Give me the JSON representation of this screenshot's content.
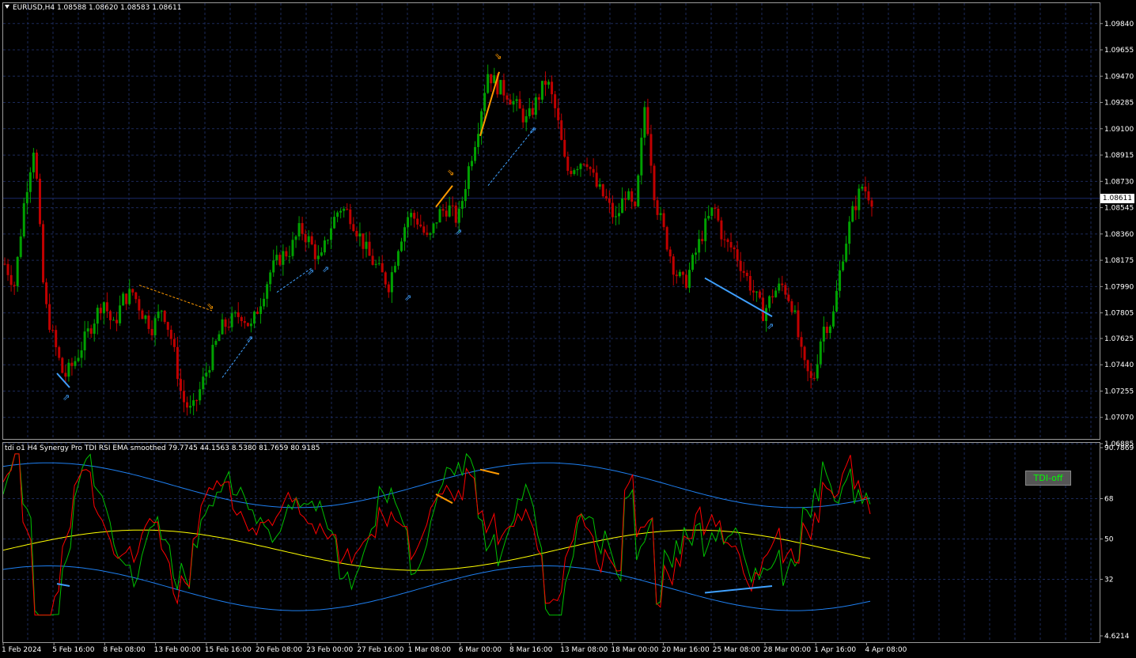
{
  "header": {
    "symbol_title": "EURUSD,H4  1.08588 1.08620 1.08583 1.08611",
    "indicator_title": "tdi o1 H4 Synergy Pro TDI RSI EMA smoothed  79.7745 44.1563 8.5380 81.7659 80.9185"
  },
  "buttons": {
    "tdi_off": "TDI-off"
  },
  "colors": {
    "background": "#000000",
    "grid": "#1c2a5a",
    "bull_candle": "#00a000",
    "bear_candle": "#c00000",
    "price_line": "#1c2a6a",
    "rsi_price": "#00c000",
    "signal_line": "#ff0000",
    "market_base": "#ffff00",
    "volatility_band": "#1e7ff0",
    "arrow_up": "#3fa0ff",
    "arrow_down": "#ff9a00",
    "divergence_bull": "#3fa0ff",
    "divergence_bear": "#ff9a00"
  },
  "chart_data": [
    {
      "type": "candlestick",
      "symbol": "EURUSD",
      "timeframe": "H4",
      "ylim": [
        1.06885,
        1.0995
      ],
      "price_ticks": [
        "1.09840",
        "1.09655",
        "1.09470",
        "1.09285",
        "1.09100",
        "1.08915",
        "1.08730",
        "1.08545",
        "1.08360",
        "1.08175",
        "1.07990",
        "1.07805",
        "1.07625",
        "1.07440",
        "1.07255",
        "1.07070",
        "1.06885"
      ],
      "current_price": "1.08611",
      "time_labels": [
        "1 Feb 2024",
        "5 Feb 16:00",
        "8 Feb 08:00",
        "13 Feb 00:00",
        "15 Feb 16:00",
        "20 Feb 08:00",
        "23 Feb 00:00",
        "27 Feb 16:00",
        "1 Mar 08:00",
        "6 Mar 00:00",
        "8 Mar 16:00",
        "13 Mar 08:00",
        "18 Mar 00:00",
        "20 Mar 16:00",
        "25 Mar 08:00",
        "28 Mar 00:00",
        "1 Apr 16:00",
        "4 Apr 08:00"
      ],
      "close_path": [
        1.0815,
        1.08,
        1.086,
        1.09,
        1.079,
        1.076,
        1.0735,
        1.0745,
        1.076,
        1.0775,
        1.079,
        1.077,
        1.079,
        1.0795,
        1.078,
        1.077,
        1.0785,
        1.076,
        1.072,
        1.071,
        1.073,
        1.075,
        1.077,
        1.0775,
        1.078,
        1.077,
        1.079,
        1.081,
        1.082,
        1.0825,
        1.084,
        1.083,
        1.0815,
        1.084,
        1.0855,
        1.085,
        1.0835,
        1.082,
        1.081,
        1.08,
        1.083,
        1.085,
        1.0845,
        1.083,
        1.085,
        1.0855,
        1.0845,
        1.088,
        1.091,
        1.095,
        1.094,
        1.0935,
        1.0925,
        1.0915,
        1.093,
        1.0945,
        1.092,
        1.088,
        1.0885,
        1.089,
        1.087,
        1.086,
        1.0845,
        1.0865,
        1.085,
        1.093,
        1.086,
        1.0835,
        1.081,
        1.08,
        1.082,
        1.084,
        1.0855,
        1.083,
        1.0825,
        1.081,
        1.0795,
        1.078,
        1.0795,
        1.08,
        1.0785,
        1.0745,
        1.073,
        1.077,
        1.0775,
        1.082,
        1.085,
        1.087,
        1.0861
      ],
      "signals": [
        {
          "kind": "buy",
          "price": 1.0722
        },
        {
          "kind": "sell",
          "price": 1.0786
        },
        {
          "kind": "buy",
          "price": 1.0763
        },
        {
          "kind": "buy",
          "price": 1.081
        },
        {
          "kind": "buy",
          "price": 1.0812
        },
        {
          "kind": "buy",
          "price": 1.0792
        },
        {
          "kind": "sell",
          "price": 1.088
        },
        {
          "kind": "buy",
          "price": 1.0838
        },
        {
          "kind": "sell",
          "price": 1.0962
        },
        {
          "kind": "buy",
          "price": 1.091
        },
        {
          "kind": "buy",
          "price": 1.0772
        }
      ]
    },
    {
      "type": "line",
      "name": "tdi o1 H4 Synergy Pro TDI RSI EMA smoothed",
      "ylim": [
        4.6214,
        90.7869
      ],
      "ticks": [
        "90.7869",
        "68",
        "50",
        "32",
        "4.6214"
      ],
      "levels": [
        68,
        50,
        32
      ],
      "last_values": [
        79.7745,
        44.1563,
        8.538,
        81.7659,
        80.9185
      ]
    }
  ]
}
